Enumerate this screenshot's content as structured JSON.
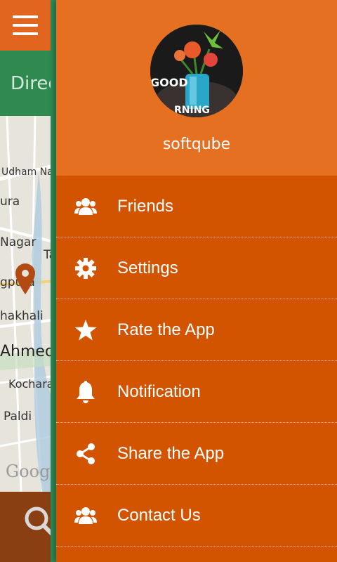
{
  "background_app": {
    "directions_label": "Direc",
    "map_labels": [
      "Udham Na",
      "ura",
      "Nagar",
      "Ta",
      "gpura",
      "hakhali",
      "Ahmed",
      "Kochara",
      "Paldi"
    ],
    "map_provider": "Google",
    "colors": {
      "header": "#e2651f",
      "directions_bar": "#2f8a50",
      "bottom_bar": "#8a3f12"
    }
  },
  "drawer": {
    "username": "softqube",
    "avatar_caption": "GOOD MORNING",
    "colors": {
      "header": "#e67022",
      "list": "#d35400",
      "text": "#ffffff"
    },
    "items": [
      {
        "label": "Friends",
        "icon": "friends-icon"
      },
      {
        "label": "Settings",
        "icon": "gear-icon"
      },
      {
        "label": "Rate the App",
        "icon": "star-icon"
      },
      {
        "label": "Notification",
        "icon": "bell-icon"
      },
      {
        "label": "Share the App",
        "icon": "share-icon"
      },
      {
        "label": "Contact Us",
        "icon": "contacts-icon"
      }
    ]
  }
}
